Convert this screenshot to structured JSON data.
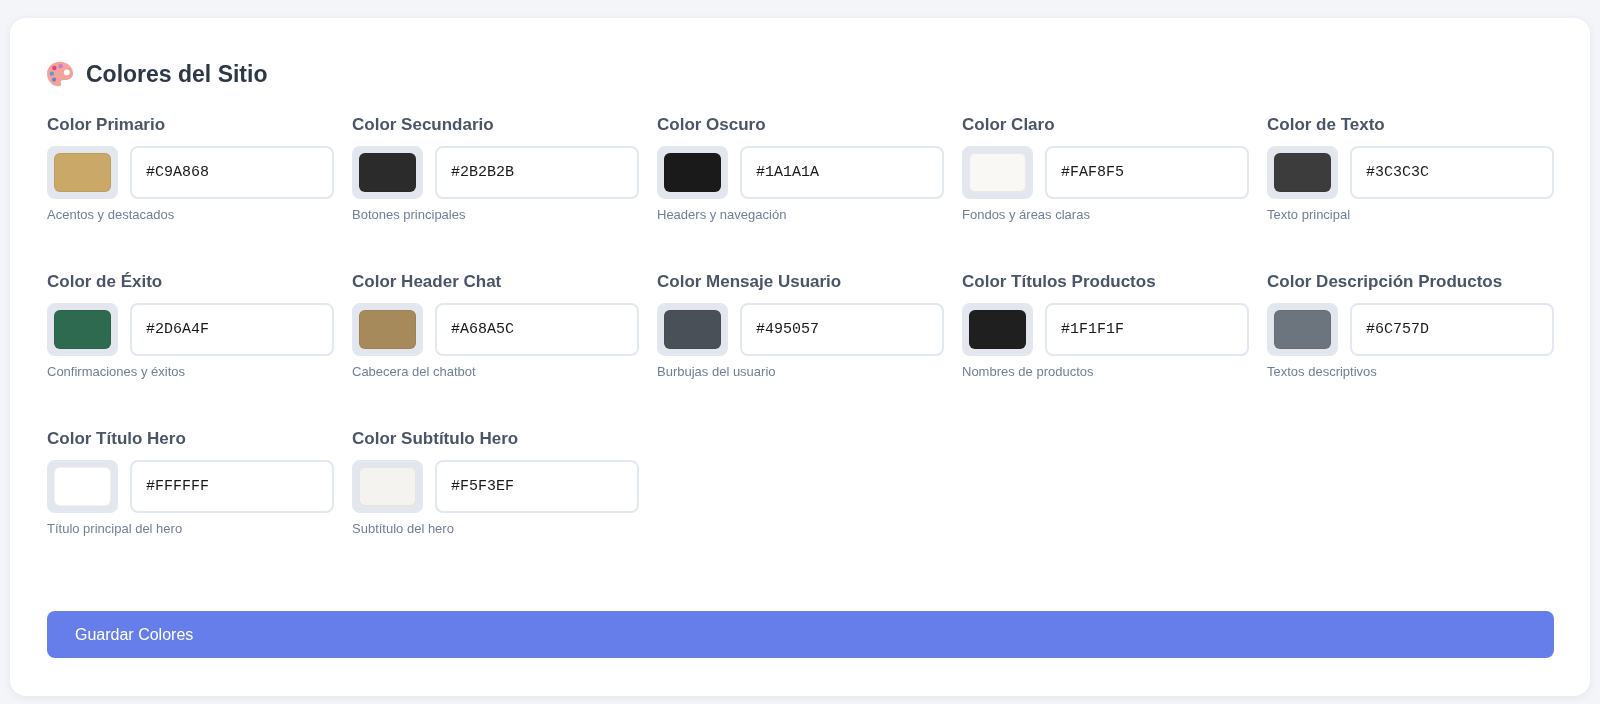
{
  "section": {
    "title": "Colores del Sitio"
  },
  "colors": [
    {
      "label": "Color Primario",
      "value": "#C9A868",
      "hint": "Acentos y destacados",
      "color": "#c9a868"
    },
    {
      "label": "Color Secundario",
      "value": "#2B2B2B",
      "hint": "Botones principales",
      "color": "#2b2b2b"
    },
    {
      "label": "Color Oscuro",
      "value": "#1A1A1A",
      "hint": "Headers y navegación",
      "color": "#1a1a1a"
    },
    {
      "label": "Color Claro",
      "value": "#FAF8F5",
      "hint": "Fondos y áreas claras",
      "color": "#faf8f5"
    },
    {
      "label": "Color de Texto",
      "value": "#3C3C3C",
      "hint": "Texto principal",
      "color": "#3c3c3c"
    },
    {
      "label": "Color de Éxito",
      "value": "#2D6A4F",
      "hint": "Confirmaciones y éxitos",
      "color": "#2d6a4f"
    },
    {
      "label": "Color Header Chat",
      "value": "#A68A5C",
      "hint": "Cabecera del chatbot",
      "color": "#a68a5c"
    },
    {
      "label": "Color Mensaje Usuario",
      "value": "#495057",
      "hint": "Burbujas del usuario",
      "color": "#495057"
    },
    {
      "label": "Color Títulos Productos",
      "value": "#1F1F1F",
      "hint": "Nombres de productos",
      "color": "#1f1f1f"
    },
    {
      "label": "Color Descripción Productos",
      "value": "#6C757D",
      "hint": "Textos descriptivos",
      "color": "#6c757d"
    },
    {
      "label": "Color Título Hero",
      "value": "#FFFFFF",
      "hint": "Título principal del hero",
      "color": "#ffffff"
    },
    {
      "label": "Color Subtítulo Hero",
      "value": "#F5F3EF",
      "hint": "Subtítulo del hero",
      "color": "#f5f3ef"
    }
  ],
  "save_button": {
    "label": "Guardar Colores"
  }
}
